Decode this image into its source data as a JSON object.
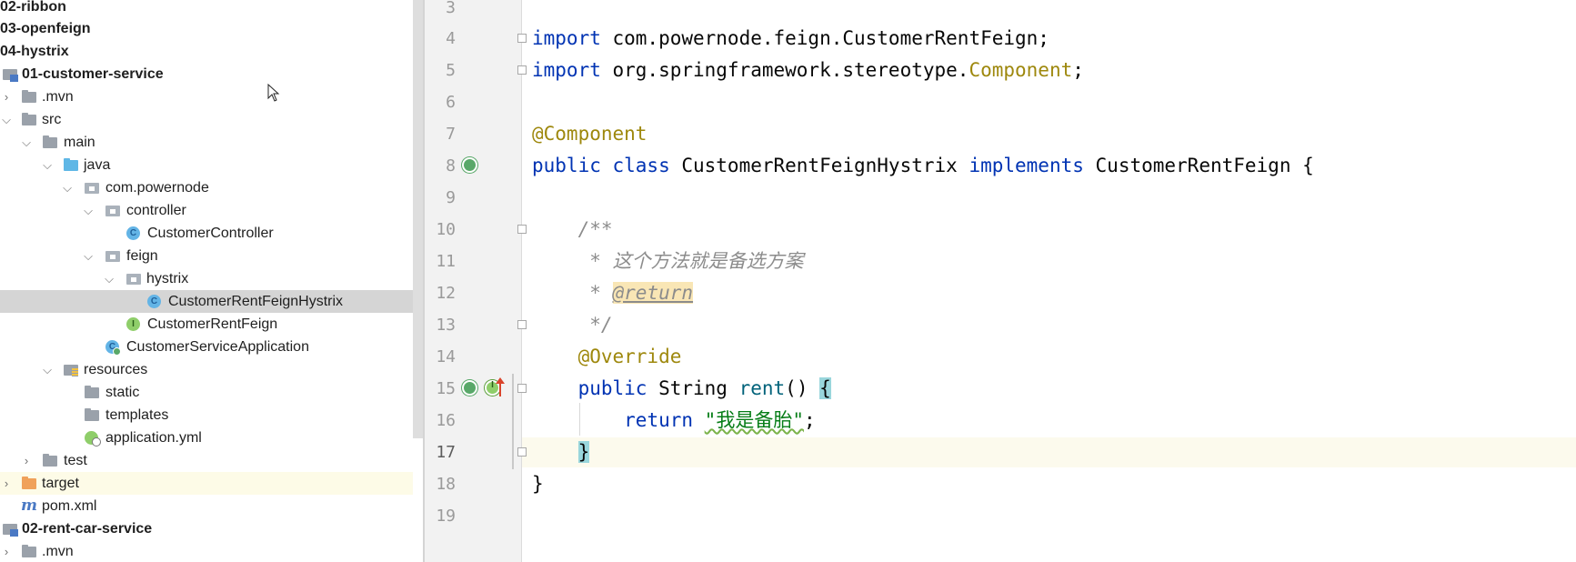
{
  "project_tree": {
    "rows": [
      {
        "label": "02-ribbon",
        "bold": true
      },
      {
        "label": "03-openfeign",
        "bold": true
      },
      {
        "label": "04-hystrix",
        "bold": true
      },
      {
        "label": "01-customer-service",
        "bold": true,
        "icon": "module-folder-icon"
      },
      {
        "label": ".mvn",
        "icon": "folder-icon",
        "expanded": false
      },
      {
        "label": "src",
        "icon": "folder-icon",
        "expanded": true
      },
      {
        "label": "main",
        "icon": "folder-icon",
        "expanded": true
      },
      {
        "label": "java",
        "icon": "source-root-folder-icon",
        "expanded": true
      },
      {
        "label": "com.powernode",
        "icon": "package-icon",
        "expanded": true
      },
      {
        "label": "controller",
        "icon": "package-icon",
        "expanded": true
      },
      {
        "label": "CustomerController",
        "icon": "class-icon"
      },
      {
        "label": "feign",
        "icon": "package-icon",
        "expanded": true
      },
      {
        "label": "hystrix",
        "icon": "package-icon",
        "expanded": true
      },
      {
        "label": "CustomerRentFeignHystrix",
        "icon": "class-icon",
        "selected": true
      },
      {
        "label": "CustomerRentFeign",
        "icon": "interface-icon"
      },
      {
        "label": "CustomerServiceApplication",
        "icon": "spring-boot-class-icon"
      },
      {
        "label": "resources",
        "icon": "resources-folder-icon",
        "expanded": true
      },
      {
        "label": "static",
        "icon": "folder-icon"
      },
      {
        "label": "templates",
        "icon": "folder-icon"
      },
      {
        "label": "application.yml",
        "icon": "yaml-config-icon"
      },
      {
        "label": "test",
        "icon": "folder-icon",
        "expanded": false
      },
      {
        "label": "target",
        "icon": "excluded-folder-icon",
        "expanded": false
      },
      {
        "label": "pom.xml",
        "icon": "maven-icon"
      },
      {
        "label": "02-rent-car-service",
        "bold": true,
        "icon": "module-folder-icon"
      },
      {
        "label": ".mvn",
        "icon": "folder-icon",
        "expanded": false
      }
    ],
    "glyphs": {
      "expanded": "⌵",
      "collapsed": "›",
      "class_letter": "C",
      "interface_letter": "I",
      "maven_letter": "m"
    }
  },
  "editor": {
    "file": "CustomerRentFeignHystrix.java",
    "current_line": 17,
    "line_numbers": [
      "3",
      "4",
      "5",
      "6",
      "7",
      "8",
      "9",
      "10",
      "11",
      "12",
      "13",
      "14",
      "15",
      "16",
      "17",
      "18",
      "19"
    ],
    "code": {
      "l4_import": "import",
      "l4_path": " com.powernode.feign.CustomerRentFeign;",
      "l5_import": "import",
      "l5_path": " org.springframework.stereotype.",
      "l5_type": "Component",
      "l5_end": ";",
      "l7_annotation": "@Component",
      "l8_public": "public",
      "l8_class": " class",
      "l8_name": " CustomerRentFeignHystrix ",
      "l8_implements": "implements",
      "l8_rest": " CustomerRentFeign {",
      "l10_comment": "    /**",
      "l11_comment": "     * 这个方法就是备选方案",
      "l12_star": "     * ",
      "l12_tag": "@return",
      "l13_comment": "     */",
      "l14_annotation": "    @Override",
      "l15_indent": "    ",
      "l15_public": "public",
      "l15_type": " String ",
      "l15_method": "rent",
      "l15_parens": "() ",
      "l15_brace": "{",
      "l16_indent": "        ",
      "l16_return": "return",
      "l16_space": " ",
      "l16_string": "\"我是备胎\"",
      "l16_end": ";",
      "l17_indent": "    ",
      "l17_brace": "}",
      "l18_brace": "}"
    }
  }
}
